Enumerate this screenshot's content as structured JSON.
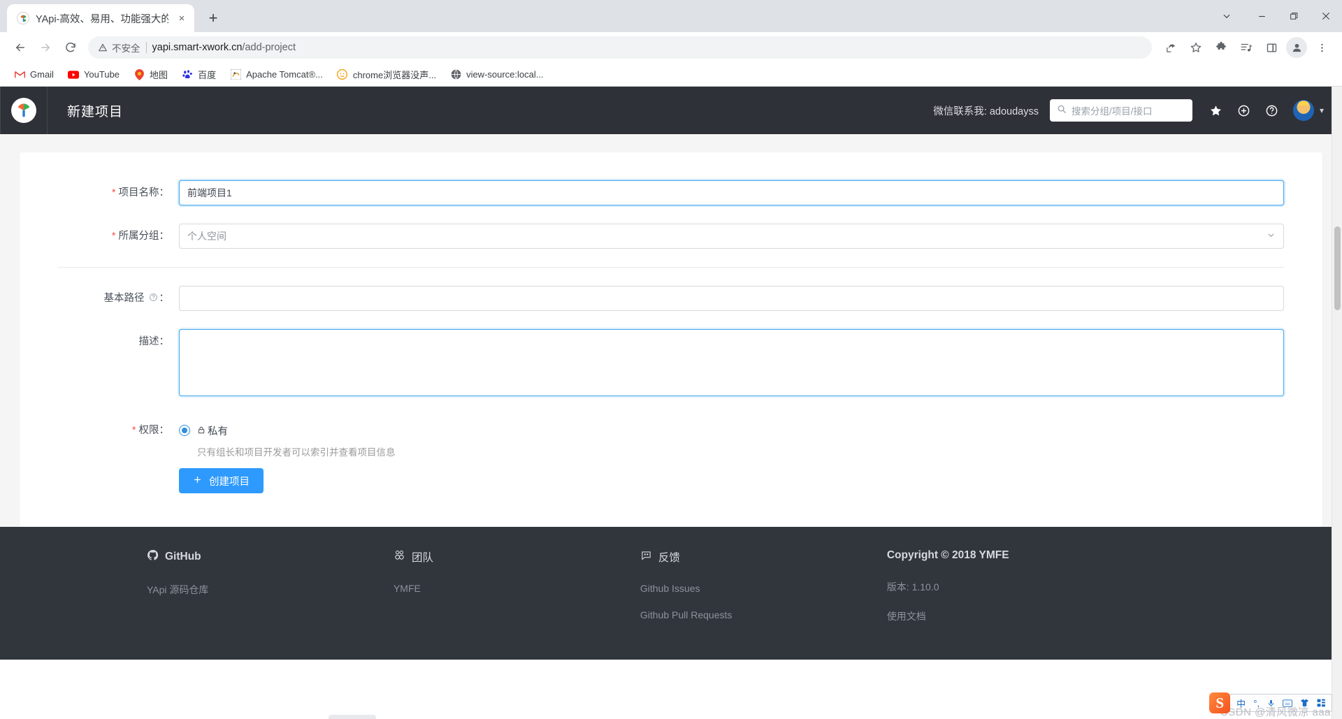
{
  "browser": {
    "tab": {
      "title": "YApi-高效、易用、功能强大的可",
      "favicon": "yapi-logo-icon",
      "close": "×"
    },
    "newtab_label": "+",
    "window_controls": {
      "tab_search": "tab-search-icon",
      "minimize": "−",
      "maximize": "▢",
      "close": "✕"
    },
    "nav": {
      "back": "back-icon",
      "forward": "forward-icon",
      "reload": "reload-icon"
    },
    "omnibox": {
      "security_label": "不安全",
      "url_host": "yapi.smart-xwork.cn",
      "url_path": "/add-project"
    },
    "toolbar_right": [
      "share-icon",
      "bookmark-star-icon",
      "extensions-icon",
      "media-list-icon",
      "side-panel-icon",
      "profile-avatar-icon",
      "menu-kebab-icon"
    ],
    "bookmarks": [
      {
        "label": "Gmail",
        "icon": "gmail-icon"
      },
      {
        "label": "YouTube",
        "icon": "youtube-icon"
      },
      {
        "label": "地图",
        "icon": "google-maps-icon"
      },
      {
        "label": "百度",
        "icon": "baidu-icon"
      },
      {
        "label": "Apache Tomcat®...",
        "icon": "tomcat-icon"
      },
      {
        "label": "chrome浏览器没声...",
        "icon": "chrome-ext-icon"
      },
      {
        "label": "view-source:local...",
        "icon": "globe-icon"
      }
    ]
  },
  "app_header": {
    "logo": "yapi-logo-icon",
    "title": "新建项目",
    "wechat_note": "微信联系我: adoudayss",
    "search_placeholder": "搜索分组/项目/接口",
    "icons": [
      "star-icon",
      "plus-circle-icon",
      "question-circle-icon"
    ],
    "avatar": "user-avatar",
    "caret": "chevron-down-icon",
    "bg_color": "#2e3138"
  },
  "form": {
    "project_name": {
      "label": "项目名称：",
      "required": true,
      "value": "前端项目1",
      "placeholder": ""
    },
    "group": {
      "label": "所属分组：",
      "required": true,
      "value": "个人空间",
      "caret": "chevron-down-icon"
    },
    "basepath": {
      "label": "基本路径",
      "help_icon": "question-circle-icon",
      "suffix": "：",
      "required": false,
      "value": "",
      "placeholder": ""
    },
    "description": {
      "label": "描述：",
      "required": false,
      "value": "",
      "placeholder": ""
    },
    "permission": {
      "label": "权限：",
      "required": true,
      "option_label": "私有",
      "option_icon": "lock-icon",
      "selected": true,
      "hint": "只有组长和项目开发者可以索引并查看项目信息"
    },
    "submit": {
      "label": "创建项目",
      "icon": "plus-icon",
      "color": "#2e9afe"
    }
  },
  "footer": {
    "columns": [
      {
        "heading": "GitHub",
        "heading_icon": "github-icon",
        "bold": true,
        "links": [
          "YApi 源码仓库"
        ]
      },
      {
        "heading": "团队",
        "heading_icon": "team-icon",
        "bold": false,
        "links": [
          "YMFE"
        ]
      },
      {
        "heading": "反馈",
        "heading_icon": "feedback-icon",
        "bold": false,
        "links": [
          "Github Issues",
          "Github Pull Requests"
        ]
      },
      {
        "heading": "Copyright © 2018 YMFE",
        "heading_icon": "",
        "bold": true,
        "links": [
          "版本: 1.10.0",
          "使用文档"
        ]
      }
    ]
  },
  "ime": {
    "logo": "S",
    "buttons": [
      "中",
      "°,",
      "mic-icon",
      "keyboard-icon",
      "skin-icon",
      "apps-grid-icon"
    ]
  },
  "watermark": "CSDN @清风微凉 aaa"
}
